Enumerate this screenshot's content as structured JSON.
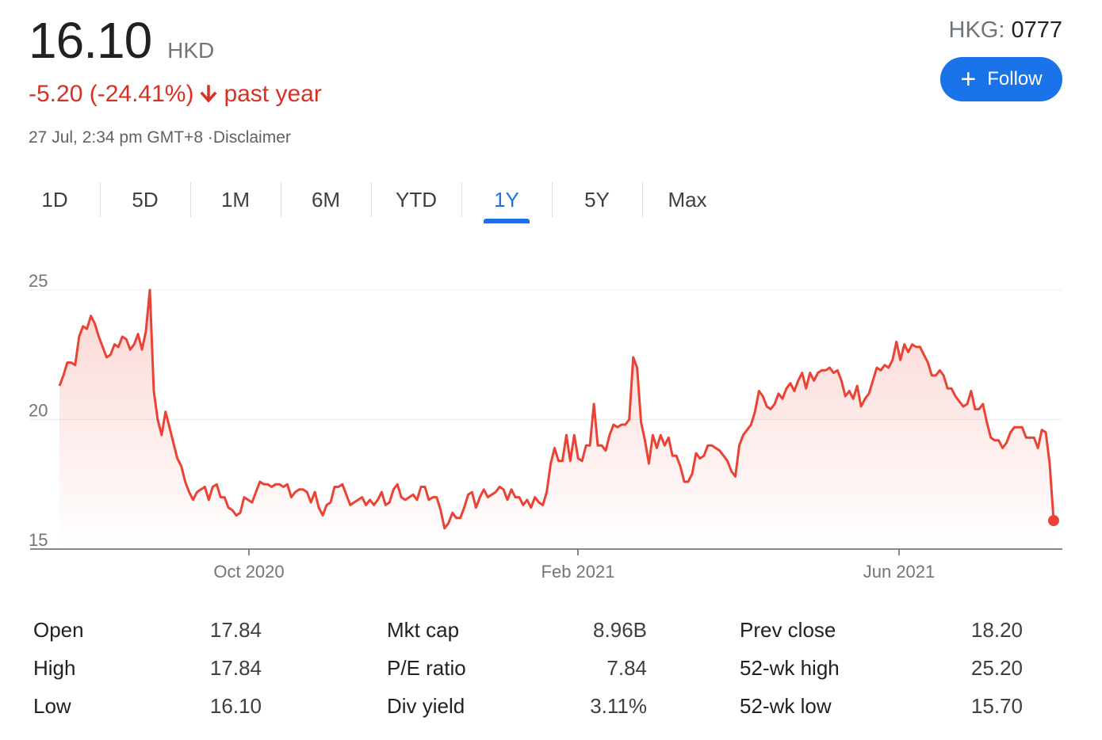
{
  "quote": {
    "price": "16.10",
    "currency": "HKD",
    "change": "-5.20 (-24.41%)",
    "period": "past year",
    "timestamp": "27 Jul, 2:34 pm GMT+8",
    "disclaimer": "·Disclaimer",
    "exchange": "HKG: ",
    "ticker": "0777",
    "follow_label": "Follow"
  },
  "tabs": [
    {
      "label": "1D"
    },
    {
      "label": "5D"
    },
    {
      "label": "1M"
    },
    {
      "label": "6M"
    },
    {
      "label": "YTD"
    },
    {
      "label": "1Y",
      "active": true
    },
    {
      "label": "5Y"
    },
    {
      "label": "Max"
    }
  ],
  "colors": {
    "line": "#ea4335",
    "accent": "#1a73e8",
    "negative": "#d93025"
  },
  "chart_data": {
    "type": "line",
    "x_ticks": [
      "Oct 2020",
      "Feb 2021",
      "Jun 2021"
    ],
    "y_ticks": [
      25,
      20,
      15
    ],
    "ylim": [
      15,
      25
    ],
    "xlabel": "",
    "ylabel": "",
    "grid": true,
    "series": [
      {
        "values": [
          21.3,
          21.7,
          22.2,
          22.2,
          22.1,
          23.2,
          23.6,
          23.5,
          24.0,
          23.7,
          23.2,
          22.8,
          22.4,
          22.5,
          22.9,
          22.8,
          23.2,
          23.1,
          22.7,
          22.9,
          23.3,
          22.7,
          23.4,
          25.0,
          21.1,
          20.0,
          19.4,
          20.3,
          19.7,
          19.1,
          18.5,
          18.2,
          17.6,
          17.2,
          16.9,
          17.2,
          17.3,
          17.4,
          16.9,
          17.4,
          17.5,
          17.0,
          17.0,
          16.6,
          16.5,
          16.3,
          16.4,
          17.0,
          16.9,
          16.8,
          17.2,
          17.6,
          17.5,
          17.5,
          17.4,
          17.5,
          17.5,
          17.4,
          17.5,
          17.0,
          17.2,
          17.3,
          17.3,
          17.2,
          16.8,
          17.2,
          16.6,
          16.3,
          16.7,
          16.8,
          17.4,
          17.4,
          17.5,
          17.1,
          16.7,
          16.8,
          16.9,
          17.0,
          16.7,
          16.9,
          16.7,
          16.9,
          17.2,
          16.7,
          16.8,
          17.3,
          17.5,
          17.0,
          16.9,
          17.0,
          17.1,
          16.9,
          17.4,
          17.4,
          16.9,
          17.0,
          17.0,
          16.5,
          15.8,
          16.0,
          16.4,
          16.2,
          16.2,
          16.6,
          17.1,
          17.2,
          16.6,
          17.0,
          17.3,
          17.0,
          17.1,
          17.2,
          17.4,
          17.3,
          16.9,
          17.3,
          17.0,
          17.0,
          16.7,
          16.9,
          16.6,
          17.0,
          16.8,
          16.7,
          17.2,
          18.3,
          18.9,
          18.4,
          18.4,
          19.4,
          18.4,
          19.4,
          18.5,
          18.4,
          19.0,
          19.0,
          20.6,
          19.0,
          19.0,
          18.8,
          19.4,
          19.8,
          19.7,
          19.8,
          19.8,
          20.0,
          22.4,
          22.0,
          19.9,
          19.2,
          18.3,
          19.4,
          18.9,
          19.4,
          19.0,
          19.3,
          18.6,
          18.6,
          18.2,
          17.6,
          17.6,
          17.9,
          18.7,
          18.5,
          18.6,
          19.0,
          19.0,
          18.9,
          18.8,
          18.6,
          18.4,
          18.0,
          17.8,
          19.0,
          19.4,
          19.6,
          19.8,
          20.3,
          21.1,
          20.9,
          20.5,
          20.4,
          20.6,
          21.0,
          20.8,
          21.2,
          21.4,
          21.1,
          21.5,
          21.8,
          21.2,
          21.8,
          21.5,
          21.8,
          21.9,
          21.9,
          22.0,
          21.8,
          21.9,
          21.5,
          20.9,
          21.1,
          20.8,
          21.3,
          20.5,
          20.8,
          21.0,
          21.5,
          22.0,
          21.9,
          22.1,
          22.0,
          22.3,
          23.0,
          22.3,
          22.9,
          22.6,
          22.9,
          22.8,
          22.8,
          22.5,
          22.2,
          21.7,
          21.7,
          21.9,
          21.7,
          21.2,
          21.2,
          20.9,
          20.7,
          20.5,
          20.6,
          21.1,
          20.4,
          20.4,
          20.6,
          19.9,
          19.3,
          19.2,
          19.2,
          18.9,
          19.1,
          19.5,
          19.7,
          19.7,
          19.7,
          19.3,
          19.3,
          19.3,
          18.9,
          19.6,
          19.5,
          18.3,
          16.1
        ]
      }
    ]
  },
  "stats": [
    [
      {
        "label": "Open",
        "value": "17.84"
      },
      {
        "label": "Mkt cap",
        "value": "8.96B"
      },
      {
        "label": "Prev close",
        "value": "18.20"
      }
    ],
    [
      {
        "label": "High",
        "value": "17.84"
      },
      {
        "label": "P/E ratio",
        "value": "7.84"
      },
      {
        "label": "52-wk high",
        "value": "25.20"
      }
    ],
    [
      {
        "label": "Low",
        "value": "16.10"
      },
      {
        "label": "Div yield",
        "value": "3.11%"
      },
      {
        "label": "52-wk low",
        "value": "15.70"
      }
    ]
  ]
}
